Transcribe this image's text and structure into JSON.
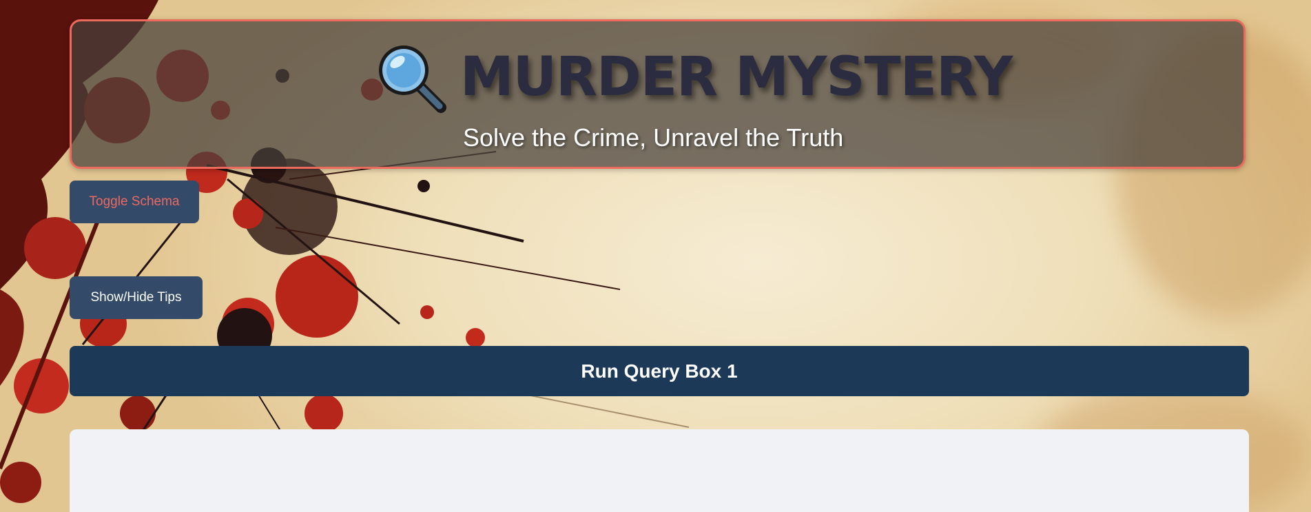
{
  "app": {
    "title": "MURDER MYSTERY",
    "subtitle": "Solve the Crime, Unravel the Truth",
    "icon": "magnifying-glass-icon"
  },
  "controls": {
    "toggle_schema_label": "Toggle Schema",
    "tips_label": "Show/Hide Tips",
    "run_query_label": "Run Query Box 1"
  },
  "colors": {
    "header_border": "#ee6a5c",
    "button_bg": "#334a68",
    "run_button_bg": "#1c3a58",
    "toggle_schema_text": "#ec6a63",
    "title_text": "#2b2c3f",
    "editor_bg": "#f1f2f5"
  }
}
